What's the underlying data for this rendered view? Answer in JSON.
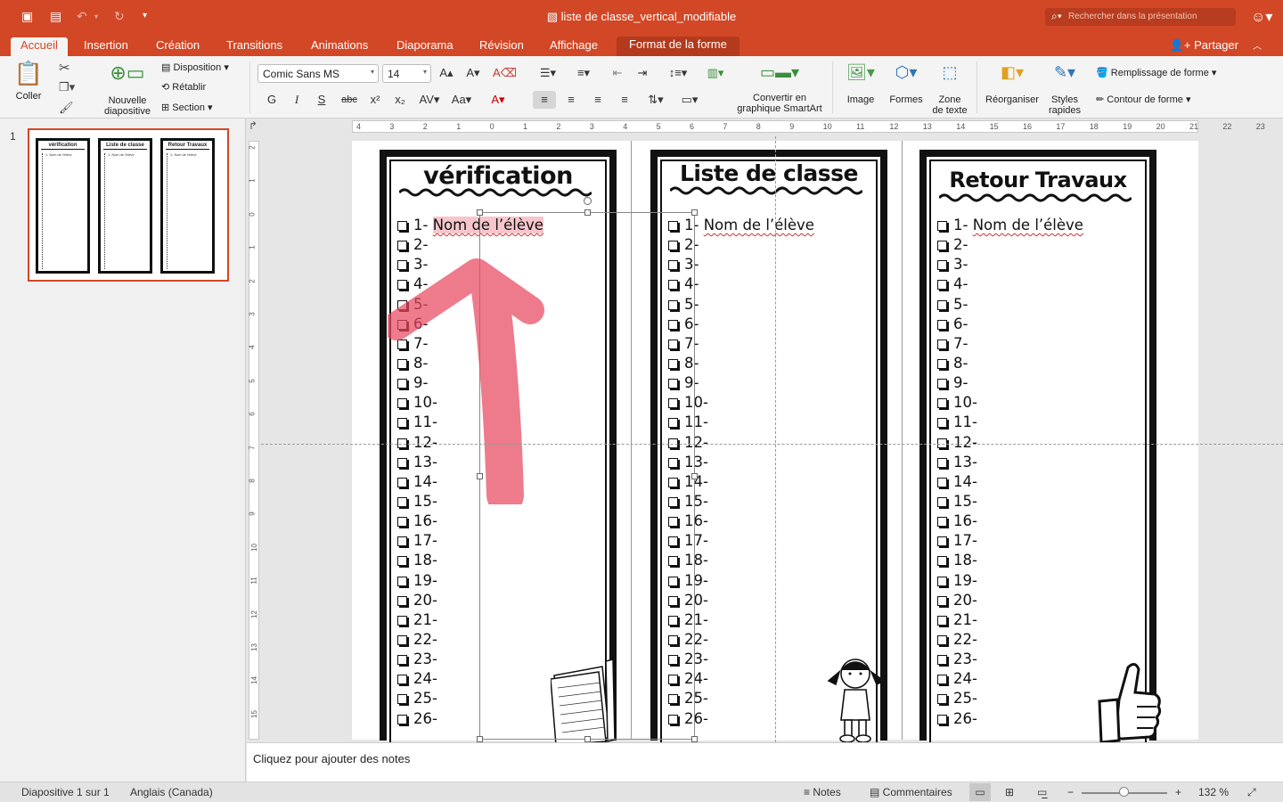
{
  "window": {
    "title": "liste de classe_vertical_modifiable",
    "search_placeholder": "Rechercher dans la présentation"
  },
  "tabs": [
    {
      "label": "Accueil"
    },
    {
      "label": "Insertion"
    },
    {
      "label": "Création"
    },
    {
      "label": "Transitions"
    },
    {
      "label": "Animations"
    },
    {
      "label": "Diaporama"
    },
    {
      "label": "Révision"
    },
    {
      "label": "Affichage"
    },
    {
      "label": "Format de la forme"
    }
  ],
  "share_label": "Partager",
  "ribbon": {
    "paste": "Coller",
    "new_slide_1": "Nouvelle",
    "new_slide_2": "diapositive",
    "layout": "Disposition",
    "reset": "Rétablir",
    "section": "Section",
    "font_name": "Comic Sans MS",
    "font_size": "14",
    "bold": "G",
    "italic": "I",
    "underline": "S",
    "strike": "abc",
    "smartart_1": "Convertir en",
    "smartart_2": "graphique SmartArt",
    "image": "Image",
    "shapes": "Formes",
    "textbox_1": "Zone",
    "textbox_2": "de texte",
    "arrange": "Réorganiser",
    "styles_1": "Styles",
    "styles_2": "rapides",
    "fill": "Remplissage de forme",
    "outline": "Contour de forme"
  },
  "slide_number": "1",
  "slide": {
    "columns": [
      {
        "title": "vérification",
        "first_name": "Nom de l’élève"
      },
      {
        "title": "Liste de classe",
        "first_name": "Nom de l’élève"
      },
      {
        "title": "Retour Travaux",
        "first_name": "Nom de l’élève"
      }
    ],
    "items": [
      "2-",
      "3-",
      "4-",
      "5-",
      "6-",
      "7-",
      "8-",
      "9-",
      "10-",
      "11-",
      "12-",
      "13-",
      "14-",
      "15-",
      "16-",
      "17-",
      "18-",
      "19-",
      "20-",
      "21-",
      "22-",
      "23-",
      "24-",
      "25-",
      "26-"
    ],
    "first_item_number": "1-"
  },
  "ruler_h": [
    "4",
    "3",
    "2",
    "1",
    "0",
    "1",
    "2",
    "3",
    "4",
    "5",
    "6",
    "7",
    "8",
    "9",
    "10",
    "11",
    "12",
    "13",
    "14",
    "15",
    "16",
    "17",
    "18",
    "19",
    "20",
    "21",
    "22",
    "23"
  ],
  "ruler_v": [
    "2",
    "1",
    "0",
    "1",
    "2",
    "3",
    "4",
    "5",
    "6",
    "7",
    "8",
    "9",
    "10",
    "11",
    "12",
    "13",
    "14",
    "15"
  ],
  "notes_placeholder": "Cliquez pour ajouter des notes",
  "status": {
    "slide_info": "Diapositive 1 sur 1",
    "language": "Anglais (Canada)",
    "notes": "Notes",
    "comments": "Commentaires",
    "zoom": "132 %",
    "zoom_fraction": 0.5
  },
  "colors": {
    "accent": "#d24726",
    "highlight": "#f7c6cc",
    "arrow": "#e8495f"
  }
}
